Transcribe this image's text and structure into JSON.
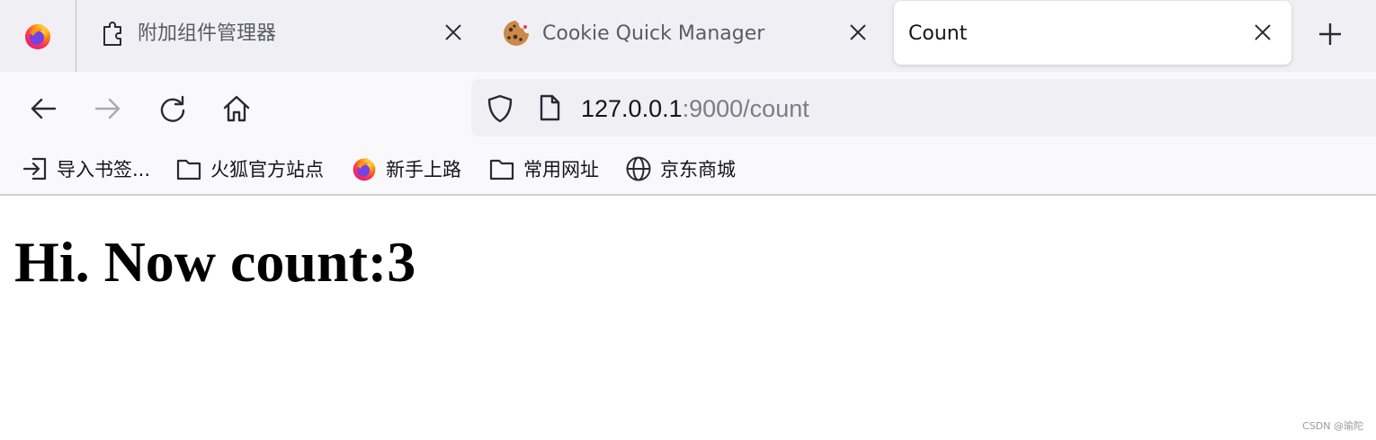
{
  "tabs": [
    {
      "label": "附加组件管理器",
      "icon": "puzzle-icon",
      "active": false
    },
    {
      "label": "Cookie Quick Manager",
      "icon": "cookie-icon",
      "active": false
    },
    {
      "label": "Count",
      "icon": "",
      "active": true
    }
  ],
  "url": {
    "host": "127.0.0.1",
    "rest": ":9000/count"
  },
  "bookmarks": [
    {
      "label": "导入书签...",
      "icon": "import-icon"
    },
    {
      "label": "火狐官方站点",
      "icon": "folder-icon"
    },
    {
      "label": "新手上路",
      "icon": "firefox-icon"
    },
    {
      "label": "常用网址",
      "icon": "folder-icon"
    },
    {
      "label": "京东商城",
      "icon": "globe-icon"
    }
  ],
  "page": {
    "heading": "Hi. Now count:3"
  },
  "watermark": "CSDN @瑜陀",
  "colors": {
    "tabbar": "#f0f0f4",
    "toolbar": "#f9f9fb",
    "urlbar": "#f0f0f4",
    "text": "#15141a",
    "url_path": "#7c7c84"
  }
}
